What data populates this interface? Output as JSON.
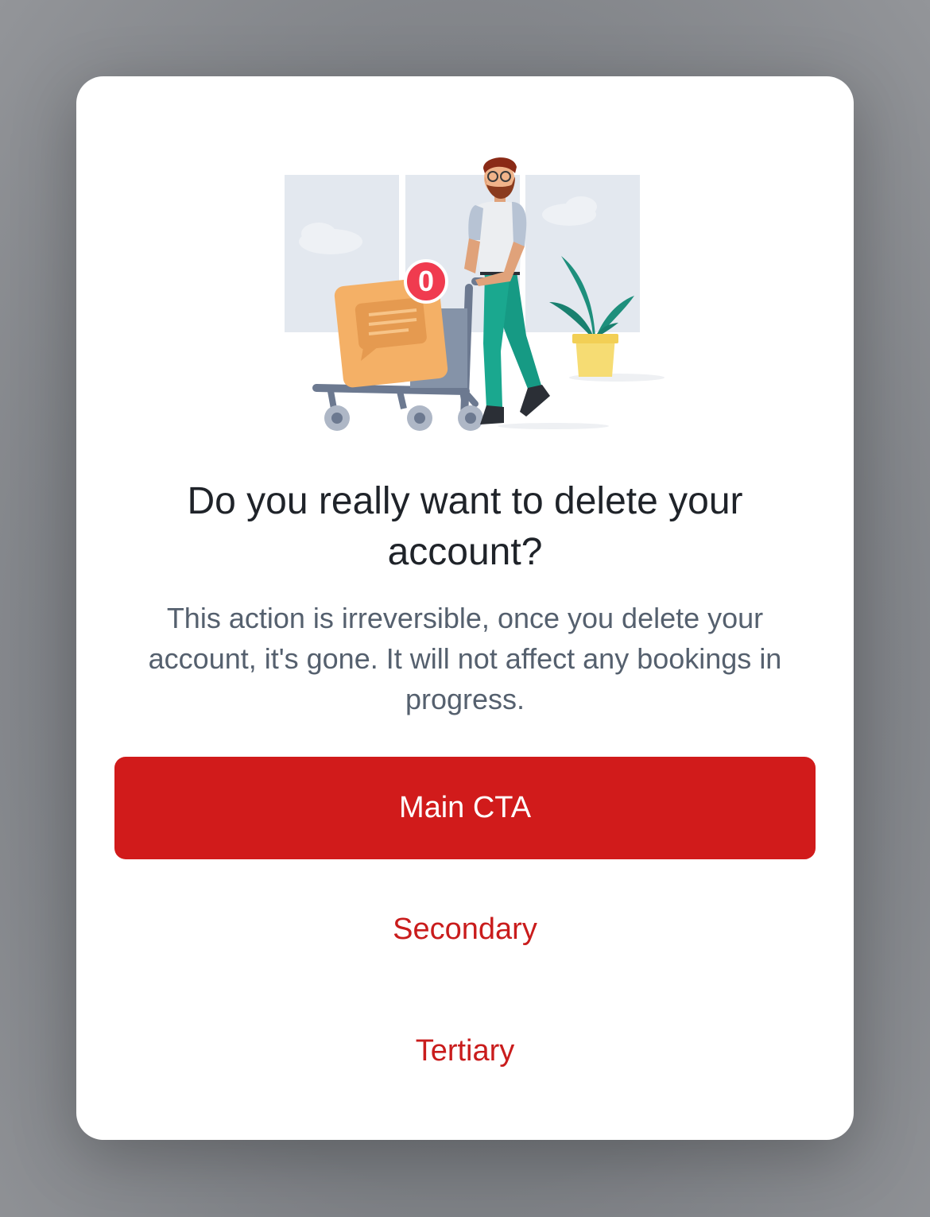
{
  "dialog": {
    "title": "Do you really want to delete your account?",
    "body": "This action is irreversible, once you delete your account, it's gone. It will not affect any bookings in progress.",
    "illustration": {
      "icon": "shopping-cart-person-illustration",
      "badge_count": "0"
    },
    "buttons": {
      "main_label": "Main CTA",
      "secondary_label": "Secondary",
      "tertiary_label": "Tertiary"
    }
  },
  "colors": {
    "primary": "#d11b1b",
    "text_primary": "#1f2329",
    "text_secondary": "#55606e",
    "backdrop": "#7c7f84"
  }
}
